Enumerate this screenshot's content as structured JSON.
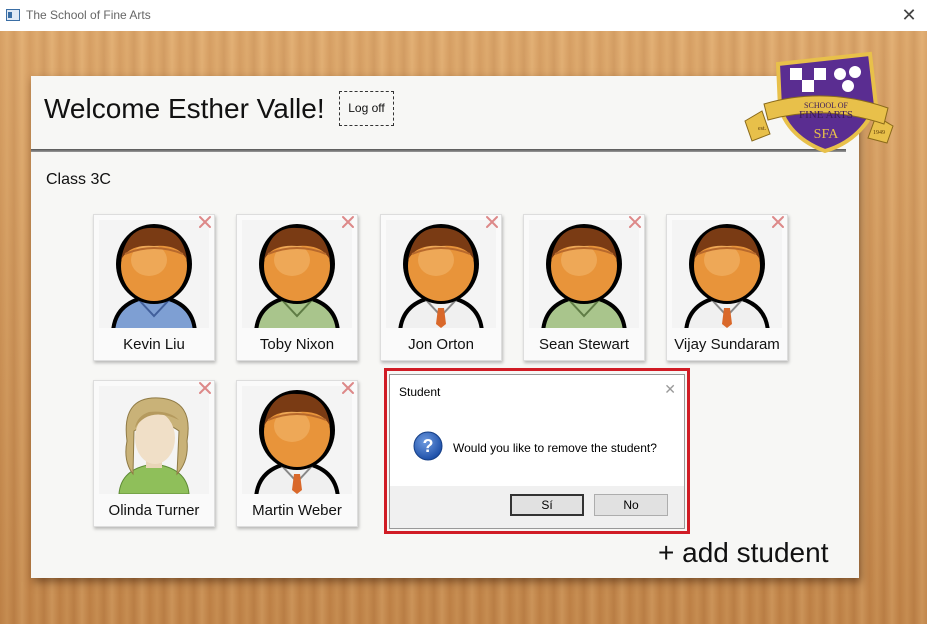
{
  "window": {
    "title": "The School of Fine Arts"
  },
  "header": {
    "welcome": "Welcome Esther Valle!",
    "logoff_label": "Log off"
  },
  "class_label": "Class 3C",
  "students": [
    {
      "name": "Kevin Liu",
      "avatar": "male-avatar-blue-sweater"
    },
    {
      "name": "Toby Nixon",
      "avatar": "male-avatar-green-jacket"
    },
    {
      "name": "Jon Orton",
      "avatar": "male-avatar-white-shirt"
    },
    {
      "name": "Sean Stewart",
      "avatar": "male-avatar-green-jacket"
    },
    {
      "name": "Vijay Sundaram",
      "avatar": "male-avatar-white-shirt"
    },
    {
      "name": "Olinda Turner",
      "avatar": "female-avatar-green-top"
    },
    {
      "name": "Martin Weber",
      "avatar": "male-avatar-white-shirt"
    }
  ],
  "add_student_label": "+ add student",
  "logo": {
    "line1": "SCHOOL OF",
    "line2": "FINE ARTS",
    "initials": "SFA",
    "left_banner": "est.",
    "right_banner": "1949"
  },
  "dialog": {
    "title": "Student",
    "message": "Would you like to remove the student?",
    "yes_label": "Sí",
    "no_label": "No"
  },
  "colors": {
    "highlight_frame": "#d01c25",
    "logo_purple": "#5a2d91",
    "logo_gold": "#e8c04a"
  }
}
